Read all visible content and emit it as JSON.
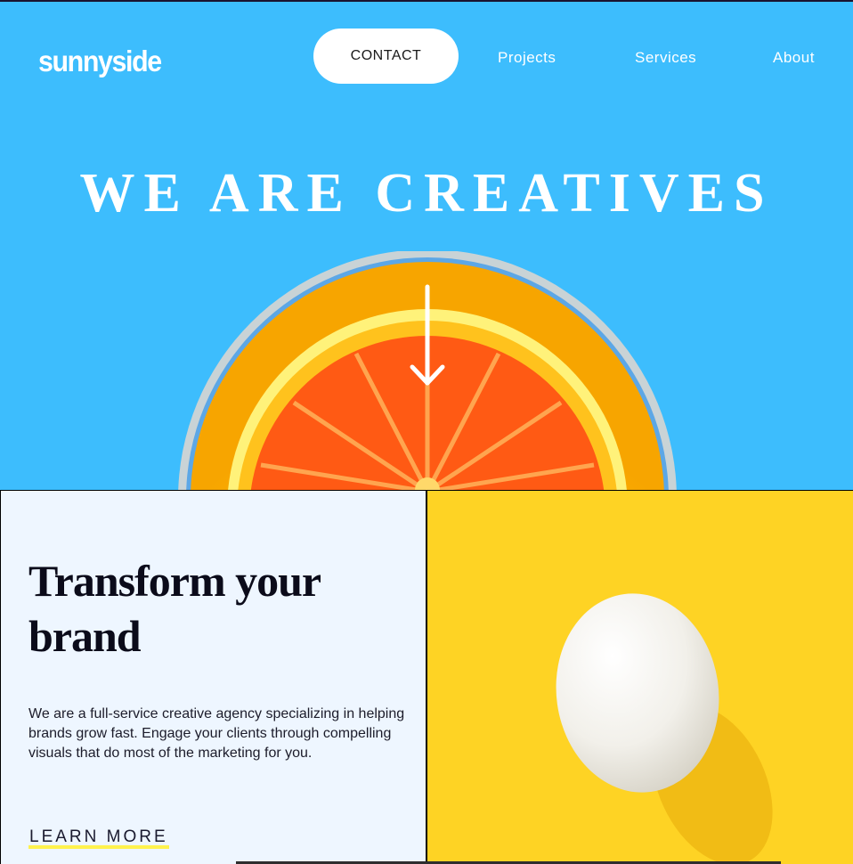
{
  "brand": {
    "name": "sunnyside"
  },
  "nav": {
    "contact": "CONTACT",
    "projects": "Projects",
    "services": "Services",
    "about": "About"
  },
  "hero": {
    "title": "WE ARE CREATIVES",
    "icon": "arrow-down-icon"
  },
  "feature": {
    "title": "Transform your brand",
    "body": "We are a full-service creative agency specializing in helping brands grow fast. Engage your clients through compelling visuals that do most of the marketing for you.",
    "cta": "LEARN MORE"
  },
  "colors": {
    "hero_bg": "#3dbdfd",
    "panel_bg": "#eef6ff",
    "egg_bg": "#fed324",
    "cta_underline": "#fff24c",
    "orange": "#ff6a1a"
  }
}
